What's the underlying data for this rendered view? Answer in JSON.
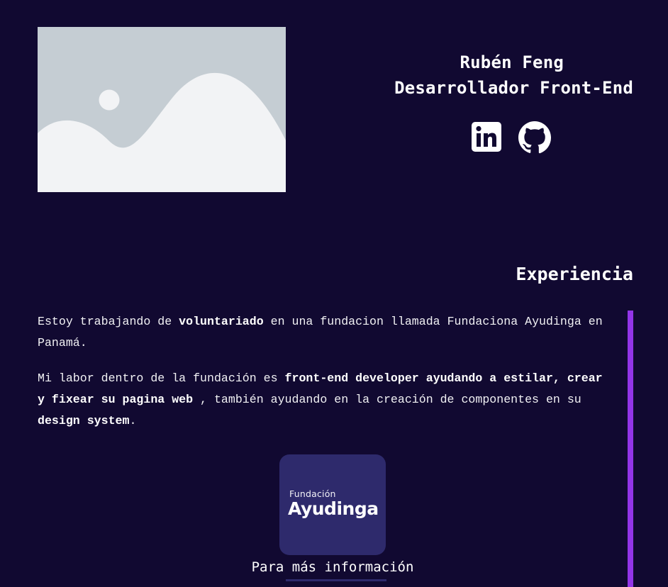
{
  "profile": {
    "name": "Rubén Feng",
    "role": "Desarrollador Front-End"
  },
  "social": {
    "linkedin_icon": "linkedin-icon",
    "github_icon": "github-icon"
  },
  "hero": {
    "image_icon": "image-placeholder-icon"
  },
  "experience": {
    "title": "Experiencia",
    "p1": {
      "a": "Estoy trabajando de ",
      "b": "voluntariado",
      "c": " en una fundacion llamada Fundaciona Ayudinga en Panamá."
    },
    "p2": {
      "a": "Mi labor dentro de la fundación es ",
      "b": "front-end developer ayudando a estilar, crear y fixear su pagina web",
      "c": " , también ayudando en la creación de componentes en su ",
      "d": "design system",
      "e": "."
    },
    "org_logo": {
      "small": "Fundación",
      "big": "Ayudinga"
    },
    "more_info": "Para más información"
  },
  "colors": {
    "background": "#110931",
    "accent": "#9335e8",
    "logo_bg": "#2e2a6c"
  }
}
